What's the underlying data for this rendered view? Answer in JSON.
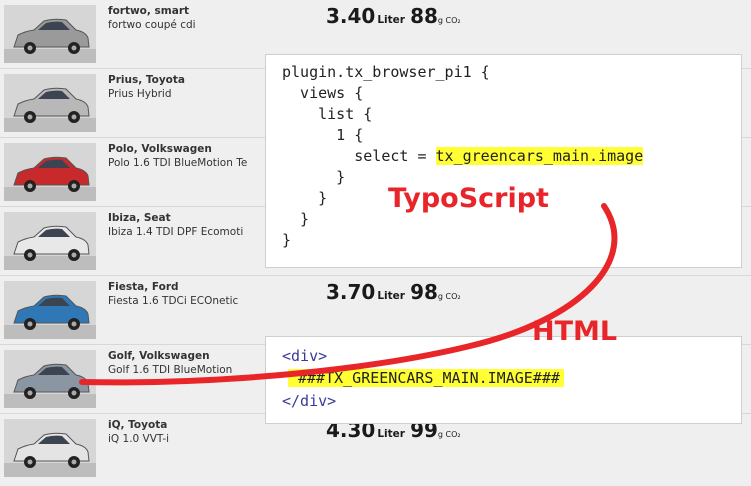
{
  "cars": [
    {
      "maker": "fortwo, smart",
      "model": "fortwo coupé cdi",
      "liters": "3.40",
      "liter_unit": "Liter",
      "co2": "88",
      "co2_unit": "g CO₂",
      "color": "#9a9a9a"
    },
    {
      "maker": "Prius, Toyota",
      "model": "Prius Hybrid",
      "color": "#b8b8b8"
    },
    {
      "maker": "Polo, Volkswagen",
      "model": "Polo 1.6 TDI BlueMotion Te",
      "color": "#c8292b"
    },
    {
      "maker": "Ibiza, Seat",
      "model": "Ibiza 1.4 TDI DPF Ecomoti",
      "color": "#e8e8e8"
    },
    {
      "maker": "Fiesta, Ford",
      "model": "Fiesta 1.6 TDCi ECOnetic",
      "liters": "3.70",
      "liter_unit": "Liter",
      "co2": "98",
      "co2_unit": "g CO₂",
      "color": "#2f78b5"
    },
    {
      "maker": "Golf, Volkswagen",
      "model": "Golf 1.6 TDI BlueMotion",
      "color": "#8a97a3"
    },
    {
      "maker": "iQ, Toyota",
      "model": "iQ 1.0 VVT-i",
      "liters": "4.30",
      "liter_unit": "Liter",
      "co2": "99",
      "co2_unit": "g CO₂",
      "color": "#e4e4e4"
    }
  ],
  "typoscript": {
    "lines": [
      "plugin.tx_browser_pi1 {",
      "  views {",
      "    list {",
      "      1 {",
      "        select = ",
      "      }",
      "    }",
      "  }",
      "}"
    ],
    "highlight": "tx_greencars_main.image",
    "label": "TypoScript"
  },
  "html_code": {
    "open_tag": "<div>",
    "marker": "###TX_GREENCARS_MAIN.IMAGE###",
    "close_tag": "</div>",
    "label": "HTML"
  },
  "colors": {
    "accent_red": "#e8262a",
    "highlight_yellow": "#ffff33",
    "tag_blue": "#3a3a9a"
  }
}
